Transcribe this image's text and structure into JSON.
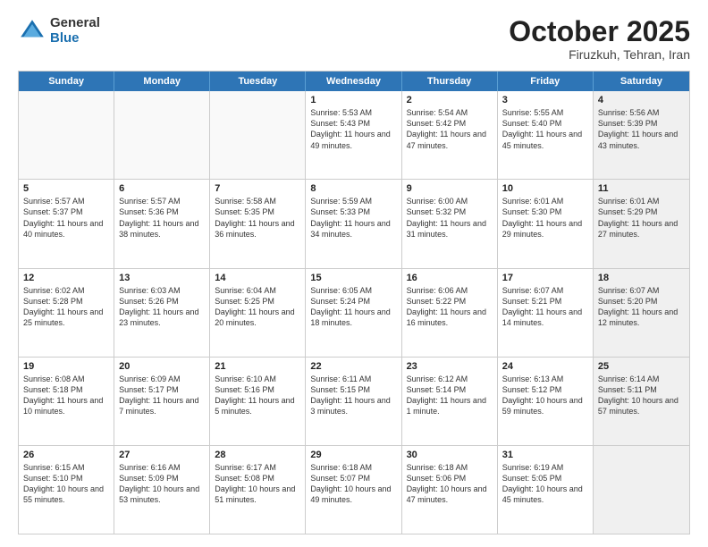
{
  "logo": {
    "general": "General",
    "blue": "Blue"
  },
  "title": "October 2025",
  "subtitle": "Firuzkuh, Tehran, Iran",
  "days_of_week": [
    "Sunday",
    "Monday",
    "Tuesday",
    "Wednesday",
    "Thursday",
    "Friday",
    "Saturday"
  ],
  "weeks": [
    [
      {
        "day": "",
        "info": "",
        "empty": true
      },
      {
        "day": "",
        "info": "",
        "empty": true
      },
      {
        "day": "",
        "info": "",
        "empty": true
      },
      {
        "day": "1",
        "info": "Sunrise: 5:53 AM\nSunset: 5:43 PM\nDaylight: 11 hours\nand 49 minutes."
      },
      {
        "day": "2",
        "info": "Sunrise: 5:54 AM\nSunset: 5:42 PM\nDaylight: 11 hours\nand 47 minutes."
      },
      {
        "day": "3",
        "info": "Sunrise: 5:55 AM\nSunset: 5:40 PM\nDaylight: 11 hours\nand 45 minutes."
      },
      {
        "day": "4",
        "info": "Sunrise: 5:56 AM\nSunset: 5:39 PM\nDaylight: 11 hours\nand 43 minutes.",
        "shaded": true
      }
    ],
    [
      {
        "day": "5",
        "info": "Sunrise: 5:57 AM\nSunset: 5:37 PM\nDaylight: 11 hours\nand 40 minutes."
      },
      {
        "day": "6",
        "info": "Sunrise: 5:57 AM\nSunset: 5:36 PM\nDaylight: 11 hours\nand 38 minutes."
      },
      {
        "day": "7",
        "info": "Sunrise: 5:58 AM\nSunset: 5:35 PM\nDaylight: 11 hours\nand 36 minutes."
      },
      {
        "day": "8",
        "info": "Sunrise: 5:59 AM\nSunset: 5:33 PM\nDaylight: 11 hours\nand 34 minutes."
      },
      {
        "day": "9",
        "info": "Sunrise: 6:00 AM\nSunset: 5:32 PM\nDaylight: 11 hours\nand 31 minutes."
      },
      {
        "day": "10",
        "info": "Sunrise: 6:01 AM\nSunset: 5:30 PM\nDaylight: 11 hours\nand 29 minutes."
      },
      {
        "day": "11",
        "info": "Sunrise: 6:01 AM\nSunset: 5:29 PM\nDaylight: 11 hours\nand 27 minutes.",
        "shaded": true
      }
    ],
    [
      {
        "day": "12",
        "info": "Sunrise: 6:02 AM\nSunset: 5:28 PM\nDaylight: 11 hours\nand 25 minutes."
      },
      {
        "day": "13",
        "info": "Sunrise: 6:03 AM\nSunset: 5:26 PM\nDaylight: 11 hours\nand 23 minutes."
      },
      {
        "day": "14",
        "info": "Sunrise: 6:04 AM\nSunset: 5:25 PM\nDaylight: 11 hours\nand 20 minutes."
      },
      {
        "day": "15",
        "info": "Sunrise: 6:05 AM\nSunset: 5:24 PM\nDaylight: 11 hours\nand 18 minutes."
      },
      {
        "day": "16",
        "info": "Sunrise: 6:06 AM\nSunset: 5:22 PM\nDaylight: 11 hours\nand 16 minutes."
      },
      {
        "day": "17",
        "info": "Sunrise: 6:07 AM\nSunset: 5:21 PM\nDaylight: 11 hours\nand 14 minutes."
      },
      {
        "day": "18",
        "info": "Sunrise: 6:07 AM\nSunset: 5:20 PM\nDaylight: 11 hours\nand 12 minutes.",
        "shaded": true
      }
    ],
    [
      {
        "day": "19",
        "info": "Sunrise: 6:08 AM\nSunset: 5:18 PM\nDaylight: 11 hours\nand 10 minutes."
      },
      {
        "day": "20",
        "info": "Sunrise: 6:09 AM\nSunset: 5:17 PM\nDaylight: 11 hours\nand 7 minutes."
      },
      {
        "day": "21",
        "info": "Sunrise: 6:10 AM\nSunset: 5:16 PM\nDaylight: 11 hours\nand 5 minutes."
      },
      {
        "day": "22",
        "info": "Sunrise: 6:11 AM\nSunset: 5:15 PM\nDaylight: 11 hours\nand 3 minutes."
      },
      {
        "day": "23",
        "info": "Sunrise: 6:12 AM\nSunset: 5:14 PM\nDaylight: 11 hours\nand 1 minute."
      },
      {
        "day": "24",
        "info": "Sunrise: 6:13 AM\nSunset: 5:12 PM\nDaylight: 10 hours\nand 59 minutes."
      },
      {
        "day": "25",
        "info": "Sunrise: 6:14 AM\nSunset: 5:11 PM\nDaylight: 10 hours\nand 57 minutes.",
        "shaded": true
      }
    ],
    [
      {
        "day": "26",
        "info": "Sunrise: 6:15 AM\nSunset: 5:10 PM\nDaylight: 10 hours\nand 55 minutes."
      },
      {
        "day": "27",
        "info": "Sunrise: 6:16 AM\nSunset: 5:09 PM\nDaylight: 10 hours\nand 53 minutes."
      },
      {
        "day": "28",
        "info": "Sunrise: 6:17 AM\nSunset: 5:08 PM\nDaylight: 10 hours\nand 51 minutes."
      },
      {
        "day": "29",
        "info": "Sunrise: 6:18 AM\nSunset: 5:07 PM\nDaylight: 10 hours\nand 49 minutes."
      },
      {
        "day": "30",
        "info": "Sunrise: 6:18 AM\nSunset: 5:06 PM\nDaylight: 10 hours\nand 47 minutes."
      },
      {
        "day": "31",
        "info": "Sunrise: 6:19 AM\nSunset: 5:05 PM\nDaylight: 10 hours\nand 45 minutes."
      },
      {
        "day": "",
        "info": "",
        "empty": true,
        "shaded": true
      }
    ]
  ]
}
